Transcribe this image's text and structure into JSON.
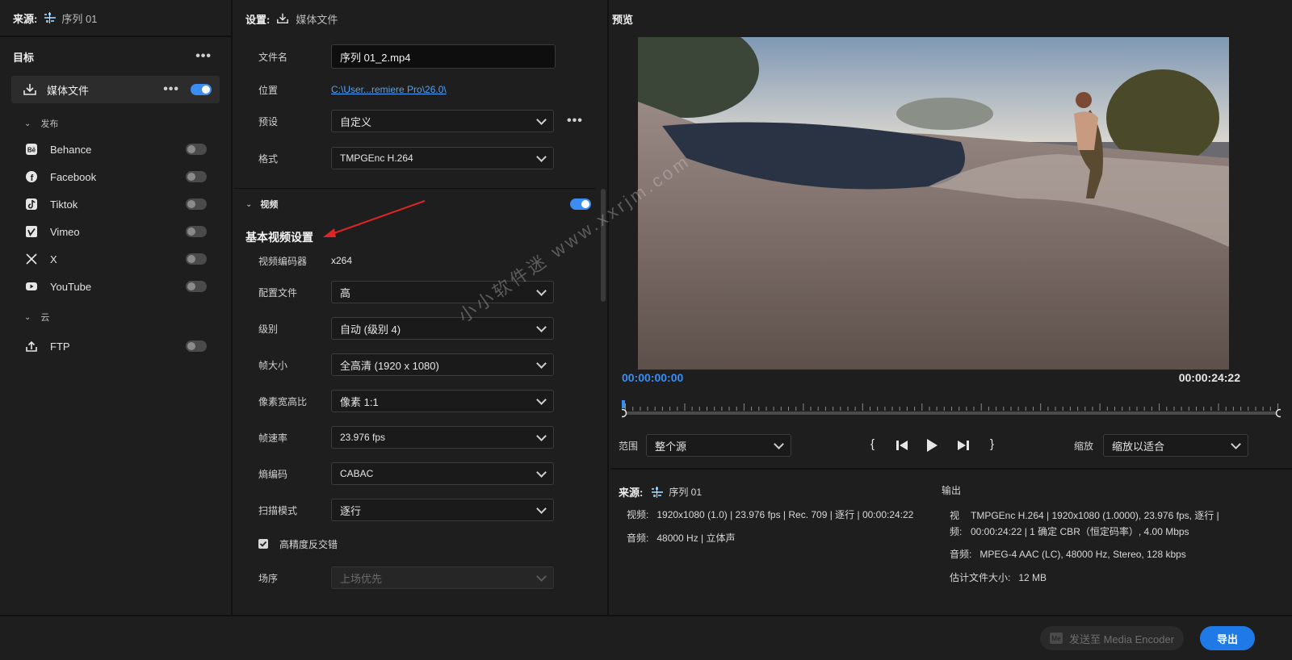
{
  "left": {
    "source_label": "来源:",
    "source_name": "序列 01",
    "targets_title": "目标",
    "media_file": "媒体文件",
    "publish_group": "发布",
    "publish_items": [
      {
        "label": "Behance",
        "icon": "behance-icon"
      },
      {
        "label": "Facebook",
        "icon": "facebook-icon"
      },
      {
        "label": "Tiktok",
        "icon": "tiktok-icon"
      },
      {
        "label": "Vimeo",
        "icon": "vimeo-icon"
      },
      {
        "label": "X",
        "icon": "x-icon"
      },
      {
        "label": "YouTube",
        "icon": "youtube-icon"
      }
    ],
    "cloud_group": "云",
    "ftp_label": "FTP"
  },
  "settings": {
    "title": "设置:",
    "subtitle": "媒体文件",
    "filename_label": "文件名",
    "filename_value": "序列 01_2.mp4",
    "location_label": "位置",
    "location_value": "C:\\User...remiere Pro\\26.0\\",
    "preset_label": "预设",
    "preset_value": "自定义",
    "format_label": "格式",
    "format_value": "TMPGEnc H.264",
    "video_section": "视频",
    "basic_video": "基本视频设置",
    "encoder_label": "视频编码器",
    "encoder_value": "x264",
    "profile_label": "配置文件",
    "profile_value": "高",
    "level_label": "级别",
    "level_value": "自动 (级别 4)",
    "framesize_label": "帧大小",
    "framesize_value": "全高清 (1920 x 1080)",
    "par_label": "像素宽高比",
    "par_value": "像素 1:1",
    "framerate_label": "帧速率",
    "framerate_value": "23.976 fps",
    "entropy_label": "熵编码",
    "entropy_value": "CABAC",
    "scan_label": "扫描模式",
    "scan_value": "逐行",
    "deinterlace_label": "高精度反交错",
    "fieldorder_label": "场序",
    "fieldorder_value": "上场优先"
  },
  "preview": {
    "title": "预览",
    "tc_start": "00:00:00:00",
    "tc_end": "00:00:24:22",
    "range_label": "范围",
    "range_value": "整个源",
    "zoom_label": "缩放",
    "zoom_value": "缩放以适合",
    "playhead_fraction": 0.0
  },
  "source_info": {
    "label": "来源:",
    "name": "序列 01",
    "video_label": "视频:",
    "video_value": "1920x1080 (1.0)  |  23.976 fps  |  Rec. 709  |  逐行  |  00:00:24:22",
    "audio_label": "音频:",
    "audio_value": "48000 Hz  |  立体声"
  },
  "output_info": {
    "label": "输出",
    "video_label_1": "视",
    "video_label_2": "频:",
    "video_line1": "TMPGEnc H.264  |  1920x1080 (1.0000), 23.976 fps, 逐行  |",
    "video_line2": "00:00:24:22  |  1 确定 CBR（恒定码率）, 4.00 Mbps",
    "audio_label": "音频:",
    "audio_value": "MPEG-4 AAC (LC), 48000 Hz, Stereo, 128 kbps",
    "size_label": "估计文件大小:",
    "size_value": "12 MB"
  },
  "bottom": {
    "send_label": "发送至 Media Encoder",
    "export_label": "导出"
  },
  "watermark": "小小软件迷 www.xxrjm.com",
  "colors": {
    "accent": "#3b8df2",
    "link": "#4aa3ff",
    "annotation": "#e02424"
  }
}
